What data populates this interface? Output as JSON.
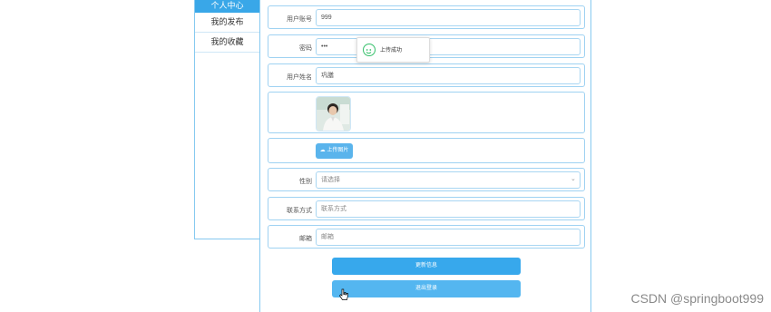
{
  "sidebar": {
    "header": "个人中心",
    "items": [
      {
        "label": "我的发布"
      },
      {
        "label": "我的收藏"
      }
    ]
  },
  "form": {
    "username": {
      "label": "用户账号",
      "value": "999"
    },
    "password": {
      "label": "密码",
      "value": "•••"
    },
    "name": {
      "label": "用户姓名",
      "value": "巩膳"
    },
    "upload": {
      "label": "上传图片"
    },
    "gender": {
      "label": "性别",
      "placeholder": "请选择"
    },
    "contact": {
      "label": "联系方式",
      "placeholder": "联系方式"
    },
    "email": {
      "label": "邮箱",
      "placeholder": "邮箱"
    }
  },
  "buttons": {
    "update": "更新信息",
    "logout": "退出登录"
  },
  "toast": {
    "message": "上传成功",
    "icon": "smile-check-icon",
    "color": "#35c06b"
  },
  "watermark": "CSDN @springboot999",
  "colors": {
    "accent": "#39a7e8",
    "border": "#9fd2f2"
  }
}
